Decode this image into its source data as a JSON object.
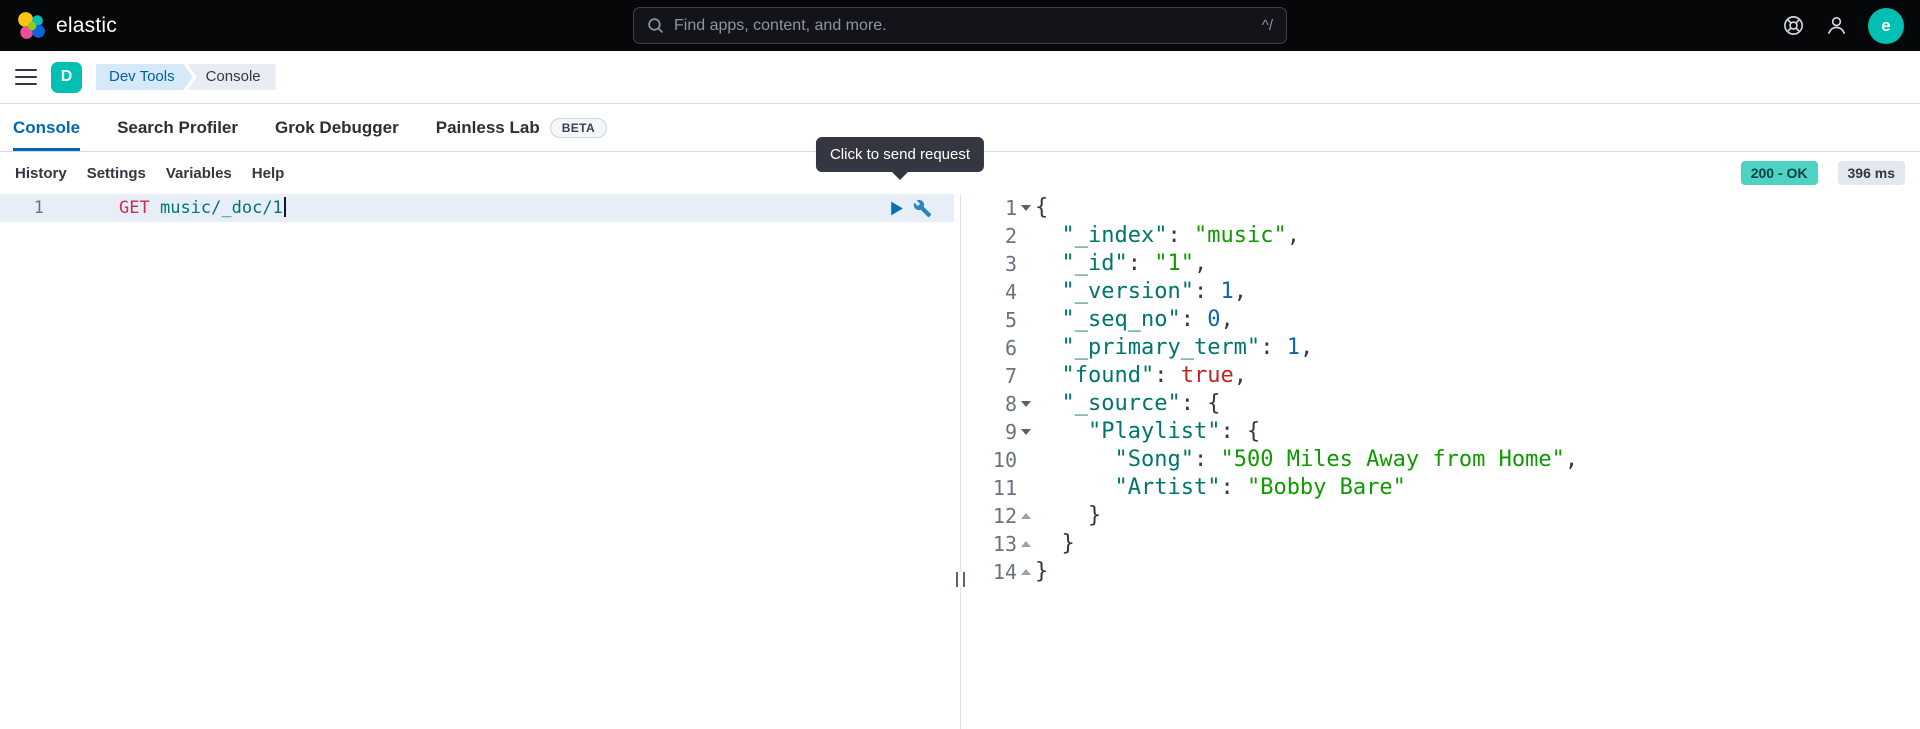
{
  "colors": {
    "brand_teal": "#00bfb3",
    "accent_blue": "#0071c2",
    "active_tab_blue": "#0068b1",
    "success_badge_bg": "#4dd2c4",
    "method_red": "#cf2b50",
    "url_teal": "#00756c",
    "json_key": "#00756c",
    "json_string": "#0e9a00",
    "json_number": "#0a66b3",
    "json_boolean": "#bd271e",
    "tooltip_bg": "#343741"
  },
  "header": {
    "brand": "elastic",
    "search_placeholder": "Find apps, content, and more.",
    "search_shortcut": "^/",
    "avatar_initial": "e"
  },
  "nav": {
    "space_initial": "D",
    "breadcrumbs": [
      "Dev Tools",
      "Console"
    ]
  },
  "tabs": [
    {
      "label": "Console",
      "active": true
    },
    {
      "label": "Search Profiler"
    },
    {
      "label": "Grok Debugger"
    },
    {
      "label": "Painless Lab",
      "badge": "BETA"
    }
  ],
  "toolbar": {
    "links": [
      "History",
      "Settings",
      "Variables",
      "Help"
    ],
    "status_badge": "200 - OK",
    "time_badge": "396 ms"
  },
  "tooltip": "Click to send request",
  "request_editor": {
    "lines": [
      {
        "number": "1",
        "active": true,
        "cursor_after": true,
        "tokens": [
          [
            "method",
            "GET"
          ],
          [
            "plain",
            " "
          ],
          [
            "url",
            "music/_doc/1"
          ]
        ]
      }
    ]
  },
  "response_editor": {
    "lines": [
      {
        "number": "1",
        "fold": "open",
        "tokens": [
          [
            "punc",
            "{"
          ]
        ]
      },
      {
        "number": "2",
        "fold": "",
        "tokens": [
          [
            "plain",
            "  "
          ],
          [
            "key",
            "\"_index\""
          ],
          [
            "punc",
            ": "
          ],
          [
            "str",
            "\"music\""
          ],
          [
            "punc",
            ","
          ]
        ]
      },
      {
        "number": "3",
        "fold": "",
        "tokens": [
          [
            "plain",
            "  "
          ],
          [
            "key",
            "\"_id\""
          ],
          [
            "punc",
            ": "
          ],
          [
            "str",
            "\"1\""
          ],
          [
            "punc",
            ","
          ]
        ]
      },
      {
        "number": "4",
        "fold": "",
        "tokens": [
          [
            "plain",
            "  "
          ],
          [
            "key",
            "\"_version\""
          ],
          [
            "punc",
            ": "
          ],
          [
            "num",
            "1"
          ],
          [
            "punc",
            ","
          ]
        ]
      },
      {
        "number": "5",
        "fold": "",
        "tokens": [
          [
            "plain",
            "  "
          ],
          [
            "key",
            "\"_seq_no\""
          ],
          [
            "punc",
            ": "
          ],
          [
            "num",
            "0"
          ],
          [
            "punc",
            ","
          ]
        ]
      },
      {
        "number": "6",
        "fold": "",
        "tokens": [
          [
            "plain",
            "  "
          ],
          [
            "key",
            "\"_primary_term\""
          ],
          [
            "punc",
            ": "
          ],
          [
            "num",
            "1"
          ],
          [
            "punc",
            ","
          ]
        ]
      },
      {
        "number": "7",
        "fold": "",
        "tokens": [
          [
            "plain",
            "  "
          ],
          [
            "key",
            "\"found\""
          ],
          [
            "punc",
            ": "
          ],
          [
            "bool",
            "true"
          ],
          [
            "punc",
            ","
          ]
        ]
      },
      {
        "number": "8",
        "fold": "open",
        "tokens": [
          [
            "plain",
            "  "
          ],
          [
            "key",
            "\"_source\""
          ],
          [
            "punc",
            ": {"
          ]
        ]
      },
      {
        "number": "9",
        "fold": "open",
        "tokens": [
          [
            "plain",
            "    "
          ],
          [
            "key",
            "\"Playlist\""
          ],
          [
            "punc",
            ": {"
          ]
        ]
      },
      {
        "number": "10",
        "fold": "",
        "tokens": [
          [
            "plain",
            "      "
          ],
          [
            "key",
            "\"Song\""
          ],
          [
            "punc",
            ": "
          ],
          [
            "str",
            "\"500 Miles Away from Home\""
          ],
          [
            "punc",
            ","
          ]
        ]
      },
      {
        "number": "11",
        "fold": "",
        "tokens": [
          [
            "plain",
            "      "
          ],
          [
            "key",
            "\"Artist\""
          ],
          [
            "punc",
            ": "
          ],
          [
            "str",
            "\"Bobby Bare\""
          ]
        ]
      },
      {
        "number": "12",
        "fold": "close",
        "tokens": [
          [
            "plain",
            "    "
          ],
          [
            "punc",
            "}"
          ]
        ]
      },
      {
        "number": "13",
        "fold": "close",
        "tokens": [
          [
            "plain",
            "  "
          ],
          [
            "punc",
            "}"
          ]
        ]
      },
      {
        "number": "14",
        "fold": "close",
        "tokens": [
          [
            "punc",
            "}"
          ]
        ]
      }
    ]
  }
}
